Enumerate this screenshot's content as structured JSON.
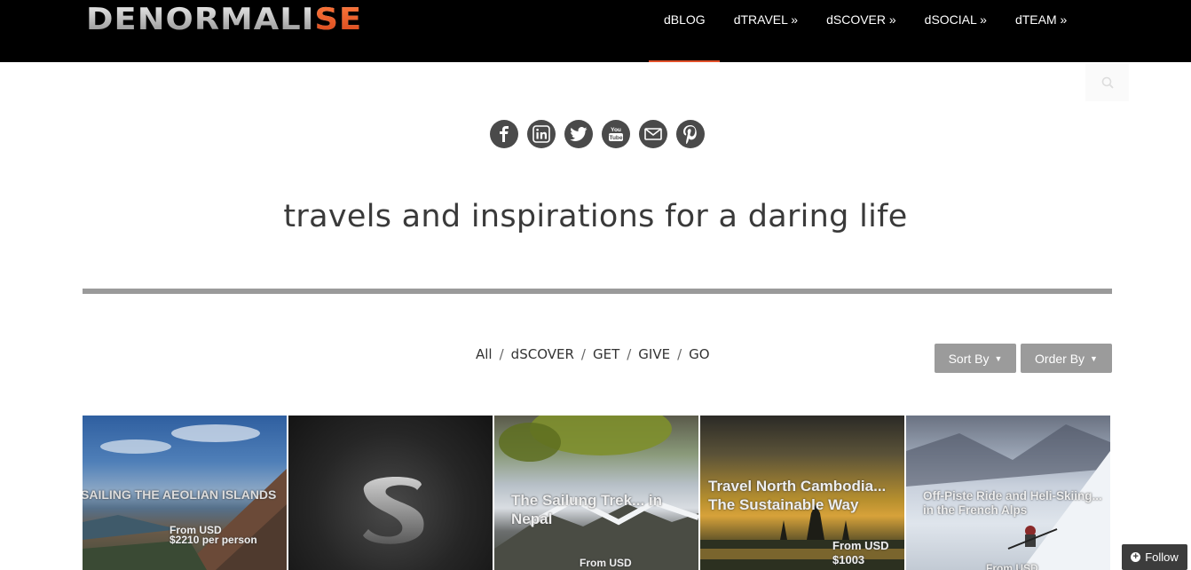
{
  "logo": {
    "text_main": "DENORMALI",
    "text_accent": "SE"
  },
  "nav": {
    "items": [
      "dBLOG",
      "dTRAVEL »",
      "dSCOVER »",
      "dSOCIAL »",
      "dTEAM »"
    ]
  },
  "social": {
    "icons": [
      "facebook-icon",
      "linkedin-icon",
      "twitter-icon",
      "youtube-icon",
      "email-icon",
      "pinterest-icon"
    ],
    "glyphs": [
      "f",
      "in",
      "t",
      "You\nTube",
      "✉",
      "P"
    ]
  },
  "tagline": "travels and inspirations for a daring life",
  "filters": {
    "all": "All",
    "discover": "dSCOVER",
    "get": "GET",
    "give": "GIVE",
    "go": "GO",
    "separator": "/"
  },
  "sort_by": "Sort By",
  "order_by": "Order By",
  "tiles": [
    {
      "title": "SAILING THE AEOLIAN ISLANDS",
      "price_line1": "From USD",
      "price_line2": "$2210 per person"
    },
    {
      "title": "",
      "price_line1": "",
      "price_line2": ""
    },
    {
      "title": "The Sailung Trek... in Nepal",
      "price_line1": "From USD",
      "price_line2": ""
    },
    {
      "title": "Travel North Cambodia... The Sustainable Way",
      "price_line1": "From USD",
      "price_line2": "$1003"
    },
    {
      "title": "Off-Piste Ride and Heli-Skiing... in the French Alps",
      "price_line1": "From USD",
      "price_line2": ""
    }
  ],
  "follow": "Follow"
}
